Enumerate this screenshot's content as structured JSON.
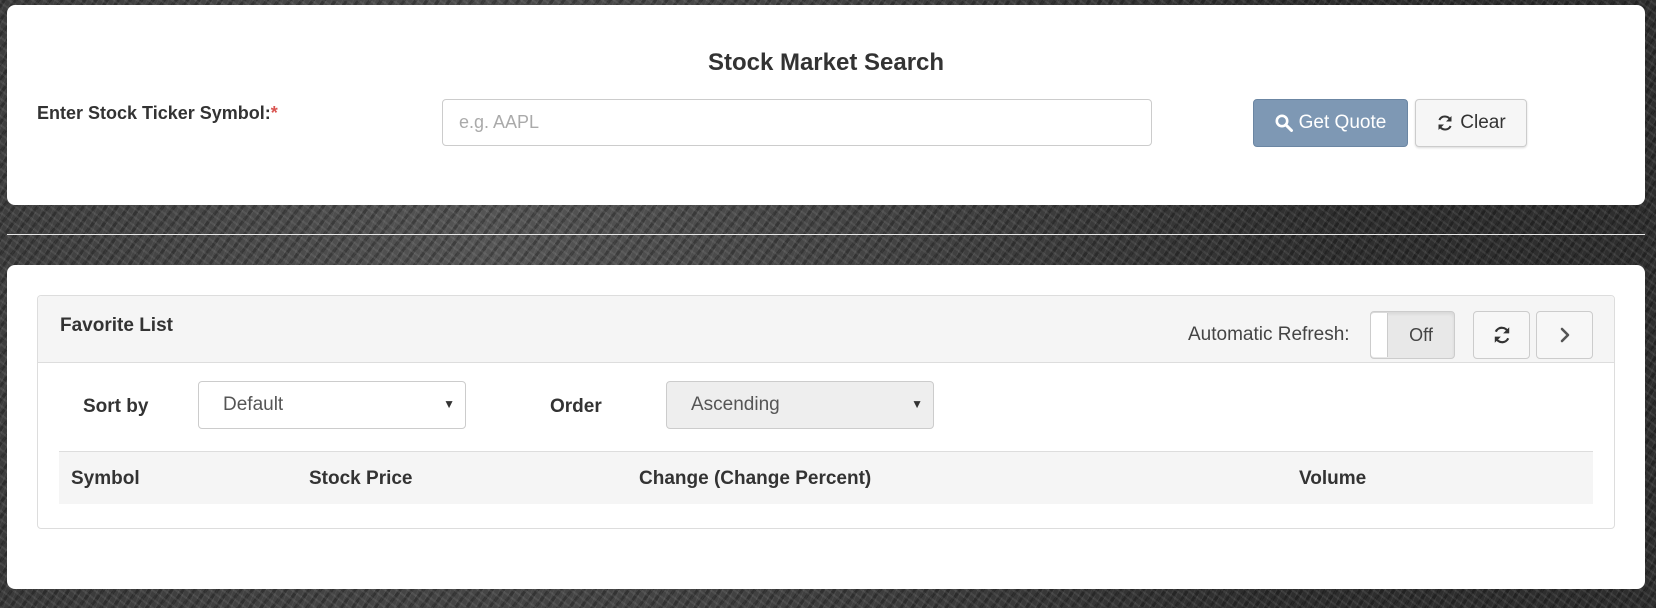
{
  "search": {
    "title": "Stock Market Search",
    "ticker_label": "Enter Stock Ticker Symbol:",
    "required_mark": "*",
    "input_placeholder": "e.g. AAPL",
    "input_value": "",
    "get_quote_label": "Get Quote",
    "clear_label": "Clear",
    "colors": {
      "get_quote_bg": "#7e98b4",
      "required": "#d9534f"
    }
  },
  "favorites": {
    "title": "Favorite List",
    "auto_refresh_label": "Automatic Refresh:",
    "toggle_state": "Off",
    "refresh_icon": "refresh-icon",
    "next_icon": "chevron-right-icon",
    "sort_label": "Sort by",
    "sort_value": "Default",
    "order_label": "Order",
    "order_value": "Ascending",
    "columns": [
      "Symbol",
      "Stock Price",
      "Change (Change Percent)",
      "Volume"
    ]
  }
}
